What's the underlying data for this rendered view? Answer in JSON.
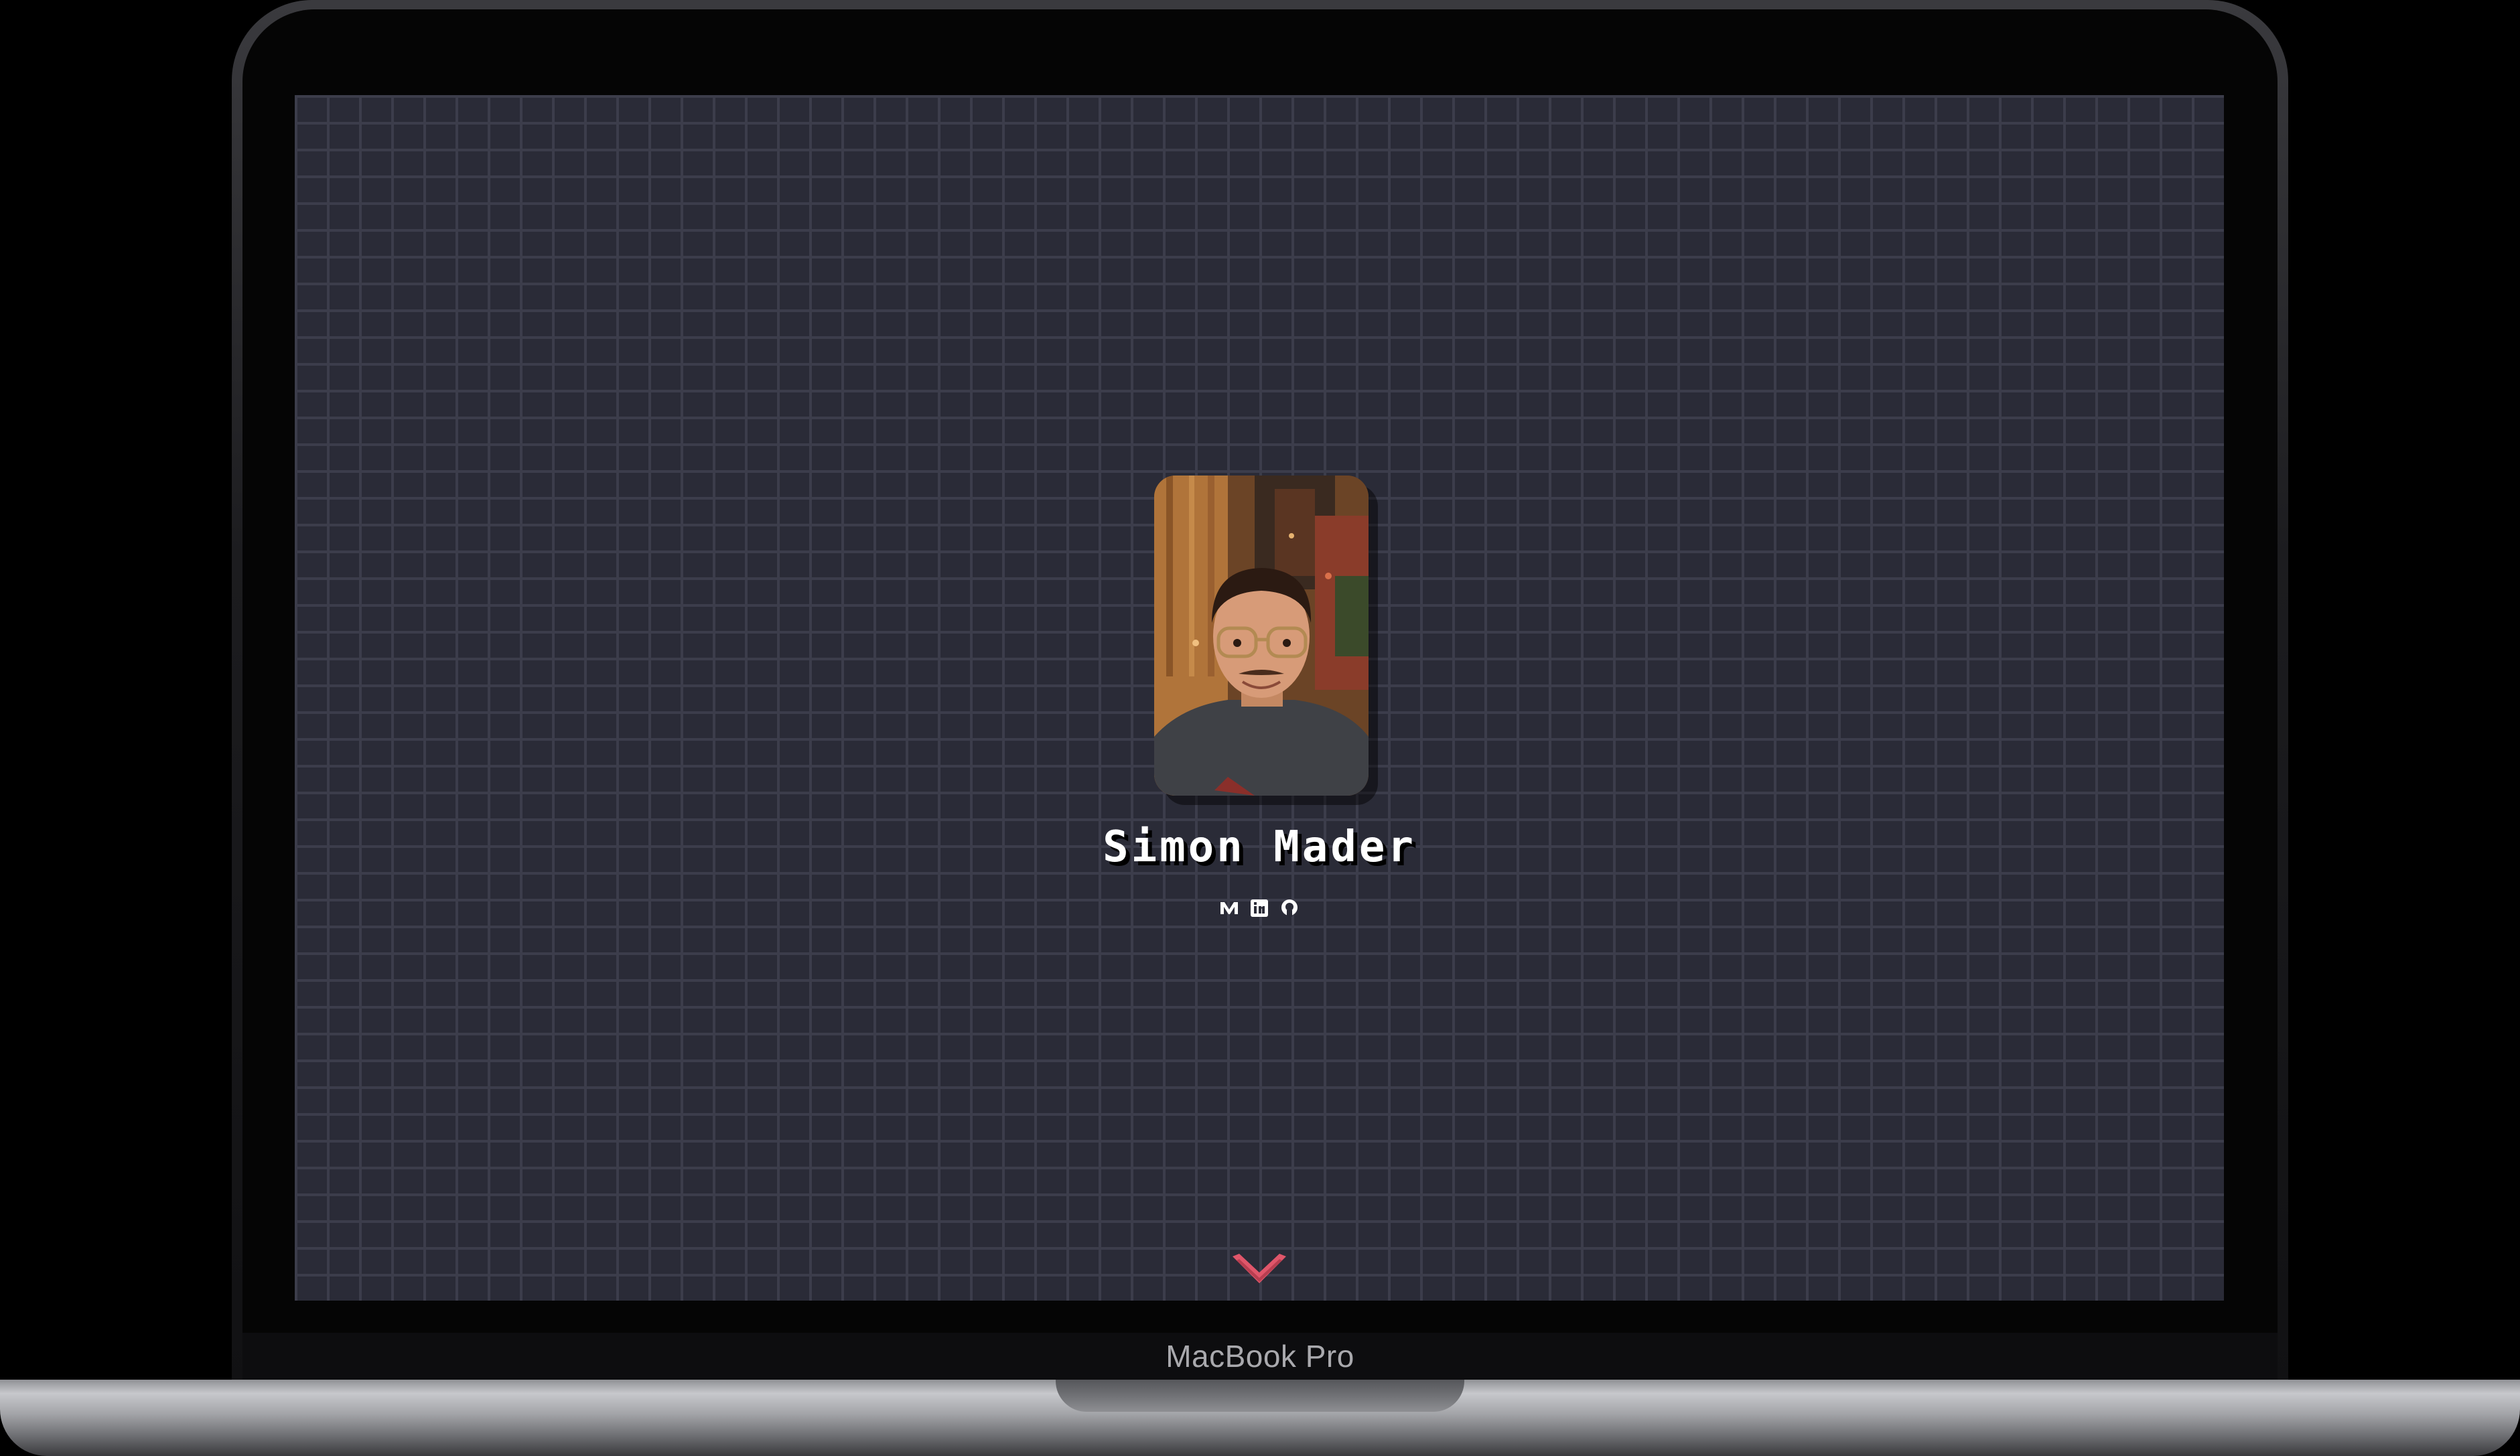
{
  "device": {
    "label": "MacBook Pro"
  },
  "profile": {
    "name": "Simon Mader",
    "photo_alt": "Portrait photo"
  },
  "social": [
    {
      "icon": "medium-icon",
      "label": "Medium"
    },
    {
      "icon": "linkedin-icon",
      "label": "LinkedIn"
    },
    {
      "icon": "github-icon",
      "label": "GitHub"
    }
  ],
  "scroll": {
    "icon": "chevron-down-icon"
  },
  "colors": {
    "background": "#2a2b37",
    "brick_mortar": "#3c3d4b",
    "name_text": "#ffffff",
    "chevron": "#e0566a"
  }
}
